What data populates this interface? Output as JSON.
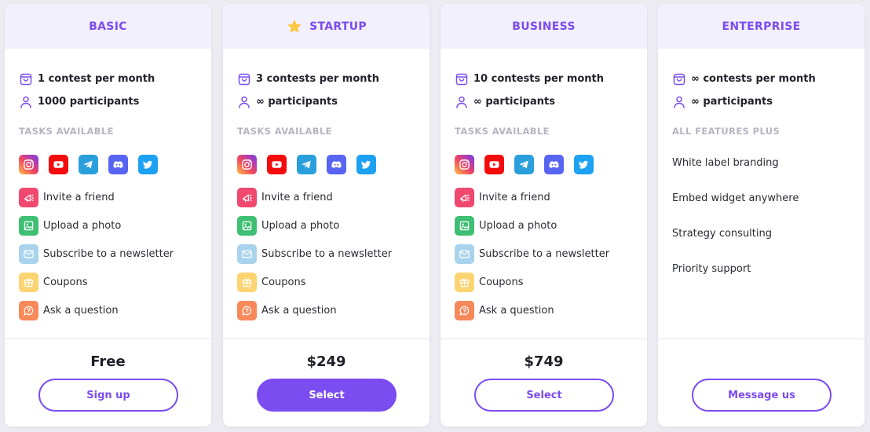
{
  "colors": {
    "accent": "#7b4cf0",
    "header_bg": "#f3f0fd"
  },
  "plans": [
    {
      "name": "BASIC",
      "featured": false,
      "contests": "1 contest per month",
      "participants": "1000 participants",
      "section_label": "TASKS AVAILABLE",
      "price": "Free",
      "cta": "Sign up"
    },
    {
      "name": "STARTUP",
      "featured": true,
      "contests": "3 contests per month",
      "participants": "∞ participants",
      "section_label": "TASKS AVAILABLE",
      "price": "$249",
      "cta": "Select"
    },
    {
      "name": "BUSINESS",
      "featured": false,
      "contests": "10 contests per month",
      "participants": "∞ participants",
      "section_label": "TASKS AVAILABLE",
      "price": "$749",
      "cta": "Select"
    },
    {
      "name": "ENTERPRISE",
      "featured": false,
      "contests": "∞ contests per month",
      "participants": "∞ participants",
      "section_label": "ALL FEATURES PLUS",
      "price": "",
      "cta": "Message us",
      "features": [
        "White label branding",
        "Embed widget anywhere",
        "Strategy consulting",
        "Priority support"
      ]
    }
  ],
  "socials": [
    {
      "name": "instagram",
      "icon": "instagram-icon"
    },
    {
      "name": "youtube",
      "icon": "youtube-icon"
    },
    {
      "name": "telegram",
      "icon": "telegram-icon"
    },
    {
      "name": "discord",
      "icon": "discord-icon"
    },
    {
      "name": "twitter",
      "icon": "twitter-icon"
    }
  ],
  "tasks": [
    {
      "label": "Invite a friend",
      "icon": "megaphone-icon",
      "color": "#f0486e"
    },
    {
      "label": "Upload a photo",
      "icon": "image-icon",
      "color": "#3fbf73"
    },
    {
      "label": "Subscribe to a newsletter",
      "icon": "mail-icon",
      "color": "#a9d3ec"
    },
    {
      "label": "Coupons",
      "icon": "gift-icon",
      "color": "#fcd472"
    },
    {
      "label": "Ask a question",
      "icon": "question-bubble-icon",
      "color": "#f7895a"
    }
  ]
}
